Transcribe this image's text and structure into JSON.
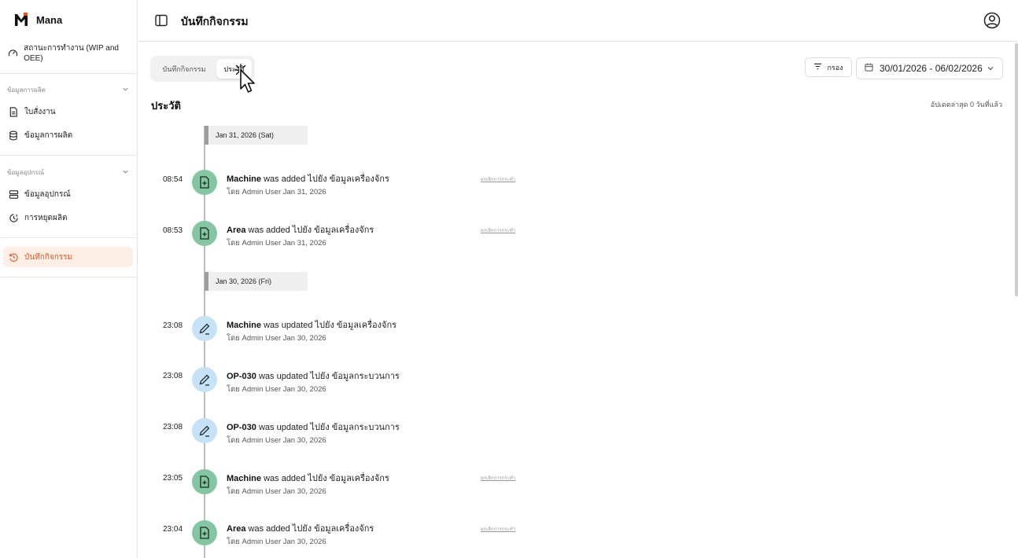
{
  "app": {
    "name": "Mana"
  },
  "sidebar": {
    "top_item": {
      "label": "สถานะการทำงาน (WIP and OEE)"
    },
    "sections": [
      {
        "title": "ข้อมูลการผลิต",
        "items": [
          {
            "label": "ใบสั่งงาน"
          },
          {
            "label": "ข้อมูลการผลิต"
          }
        ]
      },
      {
        "title": "ข้อมูลอุปกรณ์",
        "items": [
          {
            "label": "ข้อมูลอุปกรณ์"
          },
          {
            "label": "การหยุดผลิต"
          }
        ]
      }
    ],
    "active_item": {
      "label": "บันทึกกิจกรรม"
    }
  },
  "header": {
    "title": "บันทึกกิจกรรม"
  },
  "tabs": [
    {
      "label": "บันทึกกิจกรรม"
    },
    {
      "label": "ประวัติ"
    }
  ],
  "toolbar": {
    "filter_label": "กรอง",
    "date_range": "30/01/2026 - 06/02/2026"
  },
  "history": {
    "title": "ประวัติ",
    "updated": "อัปเดตล่าสุด 0 วันที่แล้ว",
    "groups": [
      {
        "date": "Jan 31, 2026 (Sat)",
        "entries": [
          {
            "time": "08:54",
            "subject": "Machine",
            "action": "was added ไปยัง ข้อมูลเครื่องจักร",
            "by": "โดย Admin User Jan 31, 2026",
            "link": "ยกเลิกการกระทำ",
            "type": "add"
          },
          {
            "time": "08:53",
            "subject": "Area",
            "action": "was added ไปยัง ข้อมูลเครื่องจักร",
            "by": "โดย Admin User Jan 31, 2026",
            "link": "ยกเลิกการกระทำ",
            "type": "add"
          }
        ]
      },
      {
        "date": "Jan 30, 2026 (Fri)",
        "entries": [
          {
            "time": "23:08",
            "subject": "Machine",
            "action": "was updated ไปยัง ข้อมูลเครื่องจักร",
            "by": "โดย Admin User Jan 30, 2026",
            "link": "",
            "type": "update"
          },
          {
            "time": "23:08",
            "subject": "OP-030",
            "action": "was updated ไปยัง ข้อมูลกระบวนการ",
            "by": "โดย Admin User Jan 30, 2026",
            "link": "",
            "type": "update"
          },
          {
            "time": "23:08",
            "subject": "OP-030",
            "action": "was updated ไปยัง ข้อมูลกระบวนการ",
            "by": "โดย Admin User Jan 30, 2026",
            "link": "",
            "type": "update"
          },
          {
            "time": "23:05",
            "subject": "Machine",
            "action": "was added ไปยัง ข้อมูลเครื่องจักร",
            "by": "โดย Admin User Jan 30, 2026",
            "link": "ยกเลิกการกระทำ",
            "type": "add"
          },
          {
            "time": "23:04",
            "subject": "Area",
            "action": "was added ไปยัง ข้อมูลเครื่องจักร",
            "by": "โดย Admin User Jan 30, 2026",
            "link": "ยกเลิกการกระทำ",
            "type": "add"
          }
        ]
      }
    ]
  },
  "colors": {
    "accent": "#e2571f",
    "add_icon_bg": "#83c7a2",
    "update_icon_bg": "#c5e2f6",
    "active_bg": "#fdeee6"
  },
  "icons": {
    "brand": "mana-logo-icon",
    "status": "gauge-icon",
    "work_order": "document-icon",
    "production_data": "database-icon",
    "equipment": "server-icon",
    "downtime": "clock-alert-icon",
    "activity_log": "history-icon",
    "add": "file-plus-icon",
    "update": "pencil-icon"
  }
}
